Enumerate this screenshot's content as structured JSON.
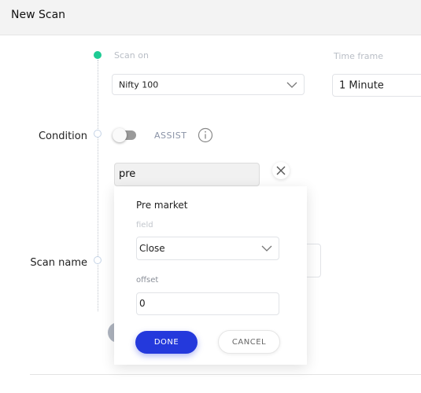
{
  "header": {
    "title": "New Scan"
  },
  "scan_on": {
    "label": "Scan on",
    "value": "Nifty 100"
  },
  "time_frame": {
    "label": "Time frame",
    "value": "1 Minute"
  },
  "condition": {
    "label": "Condition",
    "assist_label": "ASSIST",
    "assist_enabled": false,
    "input_value": "pre"
  },
  "scan_name": {
    "label": "Scan name"
  },
  "popup": {
    "title": "Pre market",
    "field_label": "field",
    "field_value": "Close",
    "offset_label": "offset",
    "offset_value": "0",
    "done_label": "DONE",
    "cancel_label": "CANCEL"
  },
  "colors": {
    "accent": "#2439dc",
    "active_step": "#1ecb94"
  }
}
